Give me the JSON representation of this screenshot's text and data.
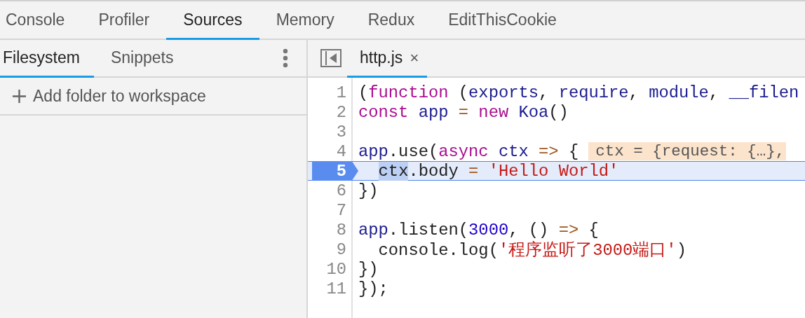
{
  "main_tabs": [
    {
      "label": "Console",
      "selected": false
    },
    {
      "label": "Profiler",
      "selected": false
    },
    {
      "label": "Sources",
      "selected": true
    },
    {
      "label": "Memory",
      "selected": false
    },
    {
      "label": "Redux",
      "selected": false
    },
    {
      "label": "EditThisCookie",
      "selected": false
    }
  ],
  "navigator": {
    "tabs": [
      {
        "label": "Filesystem",
        "selected": true
      },
      {
        "label": "Snippets",
        "selected": false
      }
    ],
    "action": "Add folder to workspace"
  },
  "editor": {
    "file_tabs": [
      {
        "label": "http.js",
        "close": "×",
        "selected": true
      }
    ],
    "lines": [
      {
        "number": "1",
        "current": false,
        "tokens": [
          {
            "text": "(",
            "kind": "plain"
          },
          {
            "text": "function",
            "kind": "keyword"
          },
          {
            "text": " (",
            "kind": "plain"
          },
          {
            "text": "exports",
            "kind": "variable"
          },
          {
            "text": ", ",
            "kind": "plain"
          },
          {
            "text": "require",
            "kind": "variable"
          },
          {
            "text": ", ",
            "kind": "plain"
          },
          {
            "text": "module",
            "kind": "variable"
          },
          {
            "text": ", ",
            "kind": "plain"
          },
          {
            "text": "__filen",
            "kind": "variable"
          }
        ]
      },
      {
        "number": "2",
        "current": false,
        "tokens": [
          {
            "text": "const",
            "kind": "keyword"
          },
          {
            "text": " app",
            "kind": "variable"
          },
          {
            "text": " =",
            "kind": "operator"
          },
          {
            "text": " new",
            "kind": "keyword"
          },
          {
            "text": " Koa",
            "kind": "variable"
          },
          {
            "text": "()",
            "kind": "plain"
          }
        ]
      },
      {
        "number": "3",
        "current": false
      },
      {
        "number": "4",
        "current": false,
        "tokens": [
          {
            "text": "app",
            "kind": "variable"
          },
          {
            "text": ".use(",
            "kind": "plain"
          },
          {
            "text": "async",
            "kind": "keyword"
          },
          {
            "text": " ctx",
            "kind": "variable"
          },
          {
            "text": " =>",
            "kind": "operator"
          },
          {
            "text": " {",
            "kind": "plain"
          }
        ],
        "inline_value": "ctx = {request: {…},"
      },
      {
        "number": "5",
        "current": true,
        "indented": true,
        "tokens": [
          {
            "text": "ctx",
            "kind": "plain",
            "highlighted": true
          },
          {
            "text": ".body",
            "kind": "plain"
          },
          {
            "text": " =",
            "kind": "operator"
          },
          {
            "text": " 'Hello World'",
            "kind": "string"
          }
        ]
      },
      {
        "number": "6",
        "current": false,
        "tokens": [
          {
            "text": "})",
            "kind": "plain"
          }
        ]
      },
      {
        "number": "7",
        "current": false
      },
      {
        "number": "8",
        "current": false,
        "tokens": [
          {
            "text": "app",
            "kind": "variable"
          },
          {
            "text": ".listen(",
            "kind": "plain"
          },
          {
            "text": "3000",
            "kind": "number"
          },
          {
            "text": ", () ",
            "kind": "plain"
          },
          {
            "text": "=>",
            "kind": "operator"
          },
          {
            "text": " {",
            "kind": "plain"
          }
        ]
      },
      {
        "number": "9",
        "current": false,
        "tokens": [
          {
            "text": "  console.log(",
            "kind": "plain"
          },
          {
            "text": "'程序监听了3000端口'",
            "kind": "string"
          },
          {
            "text": ")",
            "kind": "plain"
          }
        ]
      },
      {
        "number": "10",
        "current": false,
        "tokens": [
          {
            "text": "})",
            "kind": "plain"
          }
        ]
      },
      {
        "number": "11",
        "current": false,
        "tokens": [
          {
            "text": "});",
            "kind": "plain"
          }
        ]
      }
    ]
  }
}
